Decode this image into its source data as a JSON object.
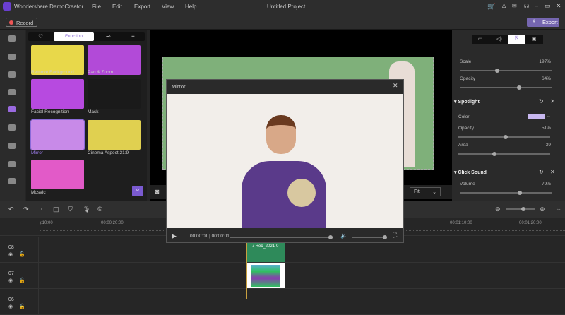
{
  "app": {
    "title": "Wondershare DemoCreator",
    "project": "Untitled Project"
  },
  "menu": [
    "File",
    "Edit",
    "Export",
    "View",
    "Help"
  ],
  "record_label": "Record",
  "export_label": "Export",
  "library": {
    "active_tab": "Function",
    "items": [
      {
        "label": "Remove Background",
        "color": "#e8d84a"
      },
      {
        "label": "Pan & Zoom",
        "color": "#b24ad8"
      },
      {
        "label": "Facial Recognition",
        "color": "#b74ae0"
      },
      {
        "label": "Mask",
        "color": "#1a1a1a"
      },
      {
        "label": "Mirror",
        "color": "#c88ae8"
      },
      {
        "label": "Cinema Aspect 21:9",
        "color": "#e0d050"
      },
      {
        "label": "Mosaic",
        "color": "#e25ac8"
      }
    ]
  },
  "preview": {
    "fit": "Fit"
  },
  "properties": {
    "cursor": {
      "scale_label": "Scale",
      "scale": "197%",
      "scale_value": 197,
      "opacity_label": "Opacity",
      "opacity": "64%",
      "opacity_value": 64
    },
    "spotlight": {
      "title": "Spotlight",
      "color_label": "Color",
      "color": "#c8b8f0",
      "opacity_label": "Opacity",
      "opacity": "51%",
      "opacity_value": 51,
      "area_label": "Area",
      "area": "39",
      "area_value": 39
    },
    "click_sound": {
      "title": "Click Sound",
      "volume_label": "Volume",
      "volume": "79%",
      "volume_value": 79
    }
  },
  "timeline": {
    "ticks": [
      "):10:00",
      "00:00:20:00",
      "00:01:10:00",
      "00:01:20:00"
    ],
    "tracks": [
      "08",
      "07",
      "06"
    ],
    "clip_label": "Rec_2021-0"
  },
  "mirror_window": {
    "title": "Mirror",
    "time": "00:00:01 | 00:00:01"
  }
}
